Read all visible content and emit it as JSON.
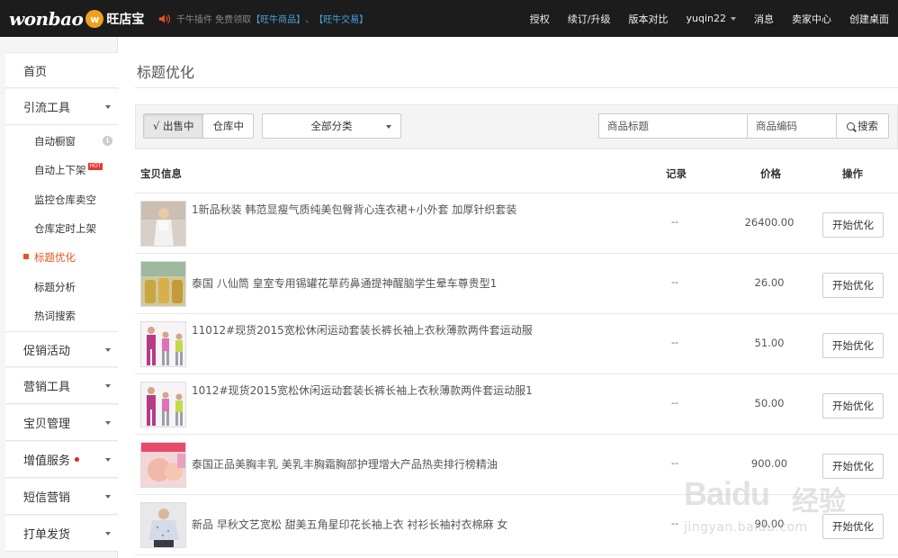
{
  "brand": {
    "logo_text": "wonbao",
    "logo_badge": "w",
    "logo_cn": "旺店宝"
  },
  "notice": {
    "text": "千牛插件 免费领取",
    "link1": "【旺牛商品】",
    "sep": "、",
    "link2": "【旺牛交易】"
  },
  "topnav": {
    "auth": "授权",
    "renew": "续订/升级",
    "compare": "版本对比",
    "user": "yuqin22",
    "messages": "消息",
    "seller_center": "卖家中心",
    "create_desktop": "创建桌面"
  },
  "sidebar": {
    "home": "首页",
    "traffic_tools": "引流工具",
    "sub": [
      {
        "label": "自动橱窗"
      },
      {
        "label": "自动上下架",
        "badge": "HOT"
      },
      {
        "label": "监控仓库卖空"
      },
      {
        "label": "仓库定时上架"
      },
      {
        "label": "标题优化",
        "active": true
      },
      {
        "label": "标题分析"
      },
      {
        "label": "热词搜索"
      }
    ],
    "promo": "促销活动",
    "marketing": "营销工具",
    "products": "宝贝管理",
    "value_added": "增值服务",
    "sms": "短信营销",
    "shipping": "打单发货"
  },
  "main": {
    "title": "标题优化",
    "filter": {
      "on_sale": "√ 出售中",
      "warehouse": "仓库中",
      "category": "全部分类",
      "title_placeholder": "商品标题",
      "code_placeholder": "商品编码",
      "search": "搜索"
    },
    "columns": {
      "info": "宝贝信息",
      "record": "记录",
      "price": "价格",
      "action": "操作"
    },
    "rows": [
      {
        "title": "1新品秋装 韩范显瘦气质纯美包臀背心连衣裙+小外套 加厚针织套装",
        "record": "--",
        "price": "26400.00",
        "action": "开始优化",
        "thumb": "dress"
      },
      {
        "title": "泰国 八仙筒 皇室专用锡罐花草药鼻通提神醒脑学生晕车尊贵型1",
        "record": "--",
        "price": "26.00",
        "action": "开始优化",
        "thumb": "tins"
      },
      {
        "title": "11012#现货2015宽松休闲运动套装长裤长袖上衣秋薄款两件套运动服",
        "record": "--",
        "price": "51.00",
        "action": "开始优化",
        "thumb": "sportswear"
      },
      {
        "title": "1012#现货2015宽松休闲运动套装长裤长袖上衣秋薄款两件套运动服1",
        "record": "--",
        "price": "50.00",
        "action": "开始优化",
        "thumb": "sportswear"
      },
      {
        "title": "泰国正品美胸丰乳 美乳丰胸霜胸部护理增大产品热卖排行榜精油",
        "record": "--",
        "price": "900.00",
        "action": "开始优化",
        "thumb": "cream"
      },
      {
        "title": "新品 早秋文艺宽松 甜美五角星印花长袖上衣 衬衫长袖衬衣棉麻 女",
        "record": "--",
        "price": "90.00",
        "action": "开始优化",
        "thumb": "shirt"
      }
    ]
  },
  "watermark": {
    "big": "Baidu",
    "cn": "经验",
    "small": "jingyan.baidu.com"
  },
  "colors": {
    "topbar": "#1c1c1c",
    "active": "#e8541e",
    "link": "#4aa3df"
  }
}
